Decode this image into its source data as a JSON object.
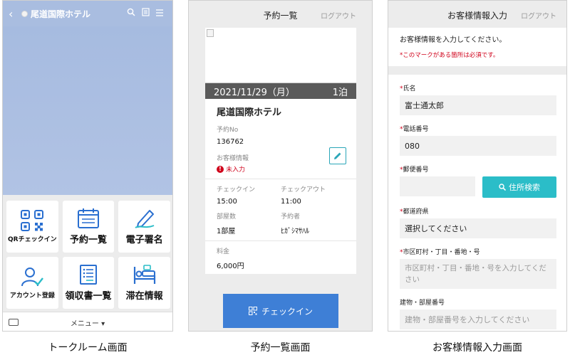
{
  "screen1": {
    "title": "尾道国際ホテル",
    "back_icon": "chevron-left-icon",
    "tiles": [
      {
        "label": "QRチェックイン",
        "icon": "qr-code-icon"
      },
      {
        "label": "予約一覧",
        "icon": "calendar-icon"
      },
      {
        "label": "電子署名",
        "icon": "pen-icon"
      },
      {
        "label": "アカウント登録",
        "icon": "user-check-icon"
      },
      {
        "label": "領収書一覧",
        "icon": "receipt-icon"
      },
      {
        "label": "滞在情報",
        "icon": "bed-icon"
      }
    ],
    "menu_label": "メニュー ▾",
    "caption": "トークルーム画面"
  },
  "screen2": {
    "title": "予約一覧",
    "logout": "ログアウト",
    "date": "2021/11/29（月）",
    "nights": "1泊",
    "hotel": "尾道国際ホテル",
    "reservation_no_label": "予約No",
    "reservation_no": "136762",
    "guest_info_label": "お客様情報",
    "guest_info_status": "未入力",
    "checkin_label": "チェックイン",
    "checkin_time": "15:00",
    "checkout_label": "チェックアウト",
    "checkout_time": "11:00",
    "rooms_label": "部屋数",
    "rooms": "1部屋",
    "reserver_label": "予約者",
    "reserver": "ﾋｶﾞｼﾏｻﾊﾙ",
    "price_label": "料金",
    "price": "6,000円",
    "checkin_button": "チェックイン",
    "caption": "予約一覧画面",
    "colors": {
      "accent": "#3e7fd6",
      "warning": "#d0021b"
    }
  },
  "screen3": {
    "title": "お客様情報入力",
    "logout": "ログアウト",
    "intro": "お客様情報を入力してください。",
    "required_note": "*このマークがある箇所は必須です。",
    "fields": {
      "name_label": "氏名",
      "name_value": "富士通太郎",
      "phone_label": "電話番号",
      "phone_value": "080",
      "zip_label": "郵便番号",
      "zip_value": "",
      "zip_button": "住所検索",
      "pref_label": "都道府県",
      "pref_value": "選択してください",
      "city_label": "市区町村・丁目・番地・号",
      "city_placeholder": "市区町村・丁目・番地・号を入力してください",
      "building_label": "建物・部屋番号",
      "building_placeholder": "建物・部屋番号を入力してください"
    },
    "caption": "お客様情報入力画面",
    "colors": {
      "button": "#2bbdc8",
      "required": "#d0021b"
    }
  }
}
